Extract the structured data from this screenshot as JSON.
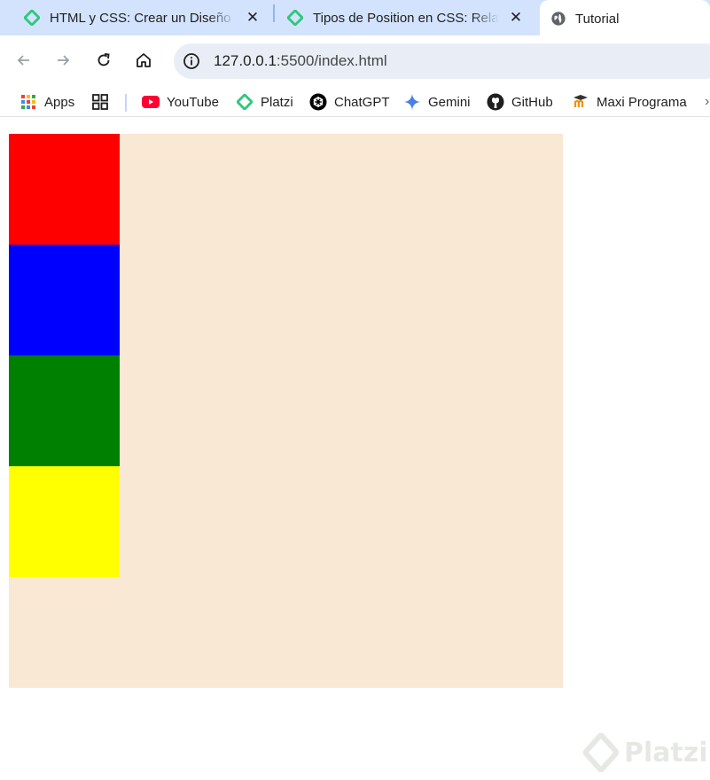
{
  "browser": {
    "tabs": [
      {
        "title": "HTML y CSS: Crear un Diseño Responsive",
        "favicon": "platzi-icon",
        "active": false
      },
      {
        "title": "Tipos de Position en CSS: Relative, Absolute",
        "favicon": "platzi-icon",
        "active": false
      },
      {
        "title": "Tutorial",
        "favicon": "globe-icon",
        "active": true
      }
    ],
    "close_glyph": "✕",
    "address_bar": {
      "host": "127.0.0.1",
      "path": ":5500/index.html"
    },
    "bookmarks": [
      {
        "label": "Apps",
        "icon": "apps-grid-icon"
      },
      {
        "label": "",
        "icon": "tab-groups-icon"
      },
      {
        "label": "YouTube",
        "icon": "youtube-icon"
      },
      {
        "label": "Platzi",
        "icon": "platzi-icon"
      },
      {
        "label": "ChatGPT",
        "icon": "chatgpt-icon"
      },
      {
        "label": "Gemini",
        "icon": "gemini-icon"
      },
      {
        "label": "GitHub",
        "icon": "github-icon"
      },
      {
        "label": "Maxi Programa",
        "icon": "maxi-icon"
      }
    ],
    "bookmarks_overflow": "›"
  },
  "page": {
    "container_color": "#f9e8d4",
    "boxes": [
      {
        "name": "red-box",
        "color": "#ff0000"
      },
      {
        "name": "blue-box",
        "color": "#0000ff"
      },
      {
        "name": "green-box",
        "color": "#008000"
      },
      {
        "name": "yellow-box",
        "color": "#ffff00"
      }
    ]
  },
  "watermark": {
    "text": "Platzi"
  }
}
